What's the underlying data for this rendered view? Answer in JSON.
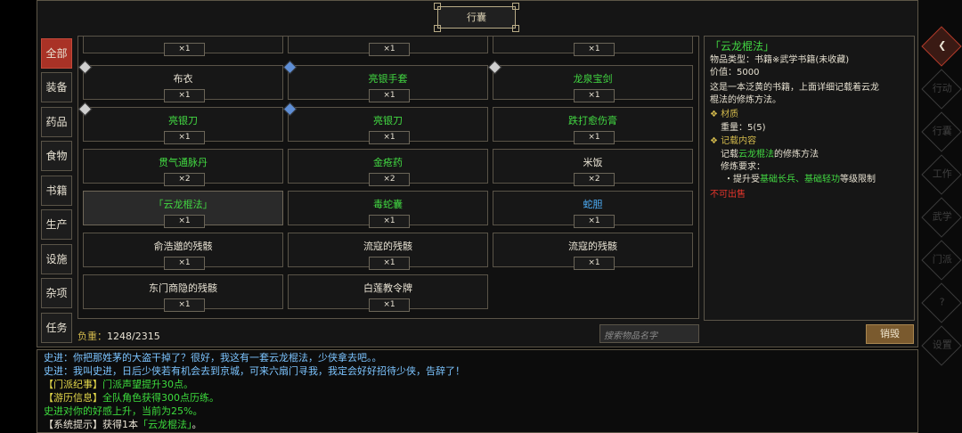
{
  "window": {
    "title": "行囊"
  },
  "tabs": [
    {
      "label": "全部",
      "active": true
    },
    {
      "label": "装备"
    },
    {
      "label": "药品"
    },
    {
      "label": "食物"
    },
    {
      "label": "书籍"
    },
    {
      "label": "生产"
    },
    {
      "label": "设施"
    },
    {
      "label": "杂项"
    },
    {
      "label": "任务"
    }
  ],
  "items": [
    {
      "name": "",
      "qty": "×1"
    },
    {
      "name": "",
      "qty": "×1"
    },
    {
      "name": "",
      "qty": "×1"
    },
    {
      "name": "布衣",
      "qty": "×1",
      "color": "white",
      "badge": "white"
    },
    {
      "name": "亮银手套",
      "qty": "×1",
      "color": "green",
      "badge": "blue"
    },
    {
      "name": "龙泉宝剑",
      "qty": "×1",
      "color": "green",
      "badge": "white"
    },
    {
      "name": "亮银刀",
      "qty": "×1",
      "color": "green",
      "badge": "white"
    },
    {
      "name": "亮银刀",
      "qty": "×1",
      "color": "green",
      "badge": "blue"
    },
    {
      "name": "跌打愈伤膏",
      "qty": "×1",
      "color": "green"
    },
    {
      "name": "贯气通脉丹",
      "qty": "×2",
      "color": "green"
    },
    {
      "name": "金疮药",
      "qty": "×2",
      "color": "green"
    },
    {
      "name": "米饭",
      "qty": "×2",
      "color": "white"
    },
    {
      "name": "「云龙棍法」",
      "qty": "×1",
      "color": "green",
      "selected": true
    },
    {
      "name": "毒蛇囊",
      "qty": "×1",
      "color": "green"
    },
    {
      "name": "蛇胆",
      "qty": "×1",
      "color": "blue"
    },
    {
      "name": "俞浩邈的残骸",
      "qty": "×1",
      "color": "white"
    },
    {
      "name": "流寇的残骸",
      "qty": "×1",
      "color": "white"
    },
    {
      "name": "流寇的残骸",
      "qty": "×1",
      "color": "white"
    },
    {
      "name": "东门商隐的残骸",
      "qty": "×1",
      "color": "white"
    },
    {
      "name": "白莲教令牌",
      "qty": "×1",
      "color": "white"
    }
  ],
  "detail": {
    "title": "「云龙棍法」",
    "type_line": "物品类型：书籍※武学书籍(未收藏)",
    "value_line": "价值：5000",
    "desc_1": "这是一本泛黄的书籍，上面详细记载着云龙",
    "desc_2": "棍法的修炼方法。",
    "material_header": "材质",
    "weight_line": "重量：5(5)",
    "content_header": "记载内容",
    "record_a": "记载",
    "record_skill": "云龙棍法",
    "record_b": "的修炼方法",
    "req_label": "修炼要求：",
    "req_a": "・提升受",
    "req_skills": "基础长兵、基础轻功",
    "req_b": "等级限制",
    "unsellable": "不可出售"
  },
  "weight": {
    "label": "负重：",
    "value": "1248/2315"
  },
  "search": {
    "placeholder": "搜索物品名字"
  },
  "destroy_label": "销毁",
  "sidebar": [
    "行动",
    "行囊",
    "工作",
    "武学",
    "门派",
    "?",
    "设置"
  ],
  "log": [
    {
      "a": "史进：",
      "b": "你把那姓茅的大盗干掉了？很好，我这有一套云龙棍法，少侠拿去吧。。"
    },
    {
      "a": "史进：",
      "b": "我叫史进，日后少侠若有机会去到京城，可来六扇门寻我，我定会好好招待少侠，告辞了！"
    },
    {
      "a": "【门派纪事】",
      "b": "门派声望提升30点。"
    },
    {
      "a": "【游历信息】",
      "b": "全队角色获得300点历练。"
    },
    {
      "a": "史进对你的好感上升，当前为25%。",
      "b": ""
    },
    {
      "a": "【系统提示】获得1本",
      "b": "「云龙棍法」",
      "c": "。"
    }
  ],
  "colors": {
    "accent_tab": "#a93226",
    "item_green": "#42d842",
    "item_blue": "#4fb3ff",
    "gold": "#d1b84c"
  }
}
